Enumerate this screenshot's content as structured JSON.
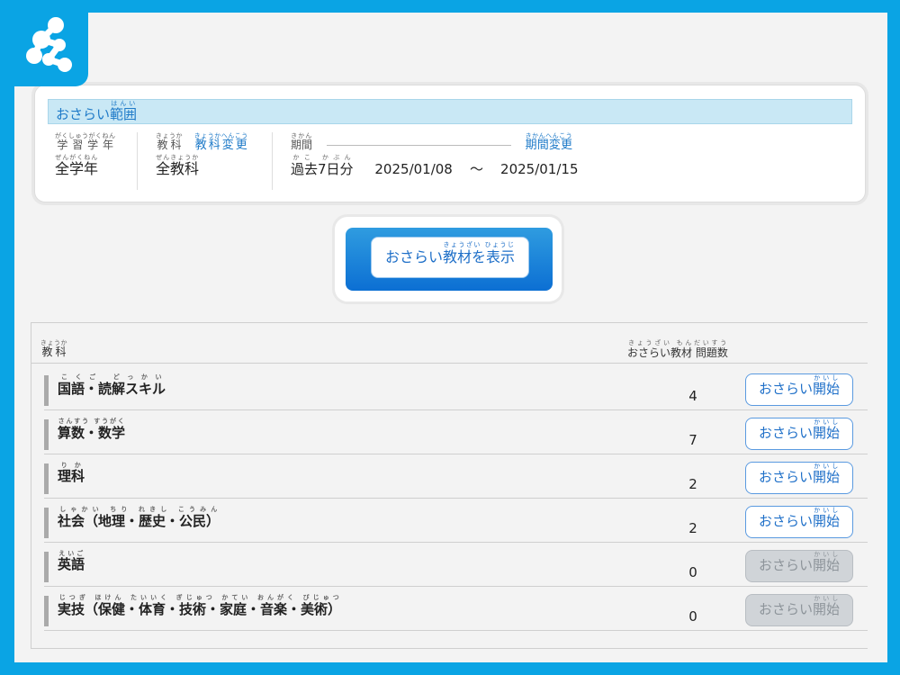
{
  "range": {
    "header_base": "おさらい",
    "header_kanji": "範囲",
    "header_ruby": "はんい",
    "grade_label": "学習学年",
    "grade_label_ruby": "がくしゅうがくねん",
    "grade_value": "全学年",
    "grade_value_ruby": "ぜんがくねん",
    "subject_label": "教科",
    "subject_label_ruby": "きょうか",
    "subject_change": "教科変更",
    "subject_change_ruby": "きょうかへんこう",
    "subject_value": "全教科",
    "subject_value_ruby": "ぜんきょうか",
    "period_label": "期間",
    "period_label_ruby": "きかん",
    "period_change": "期間変更",
    "period_change_ruby": "きかんへんこう",
    "period_value": "過去7日分",
    "period_value_ruby": "かこ かぶん",
    "date_from": "2025/01/08",
    "date_sep": "〜",
    "date_to": "2025/01/15"
  },
  "display_button": {
    "base": "おさらい",
    "kanji": "教材を表示",
    "ruby": "きょうざい ひょうじ"
  },
  "table": {
    "col_subject": "教科",
    "col_subject_ruby": "きょうか",
    "col_count": "おさらい教材 問題数",
    "col_count_ruby": "きょうざい もんだいすう",
    "rows": [
      {
        "name": "国語・読解スキル",
        "ruby": "こくご どっかい",
        "count": "4",
        "enabled": true
      },
      {
        "name": "算数・数学",
        "ruby": "さんすう すうがく",
        "count": "7",
        "enabled": true
      },
      {
        "name": "理科",
        "ruby": "りか",
        "count": "2",
        "enabled": true
      },
      {
        "name": "社会（地理・歴史・公民）",
        "ruby": "しゃかい ちり れきし こうみん",
        "count": "2",
        "enabled": true
      },
      {
        "name": "英語",
        "ruby": "えいご",
        "count": "0",
        "enabled": false
      },
      {
        "name": "実技（保健・体育・技術・家庭・音楽・美術）",
        "ruby": "じつぎ ほけん たいいく ぎじゅつ かてい おんがく びじゅつ",
        "count": "0",
        "enabled": false
      }
    ],
    "start_base": "おさらい",
    "start_kanji": "開始",
    "start_ruby": "かいし"
  },
  "colors": {
    "frame": "#0aa4e4",
    "accent_blue": "#1e6fc8",
    "header_bg": "#c9e8f5",
    "disabled_bg": "#d0d4d8"
  }
}
